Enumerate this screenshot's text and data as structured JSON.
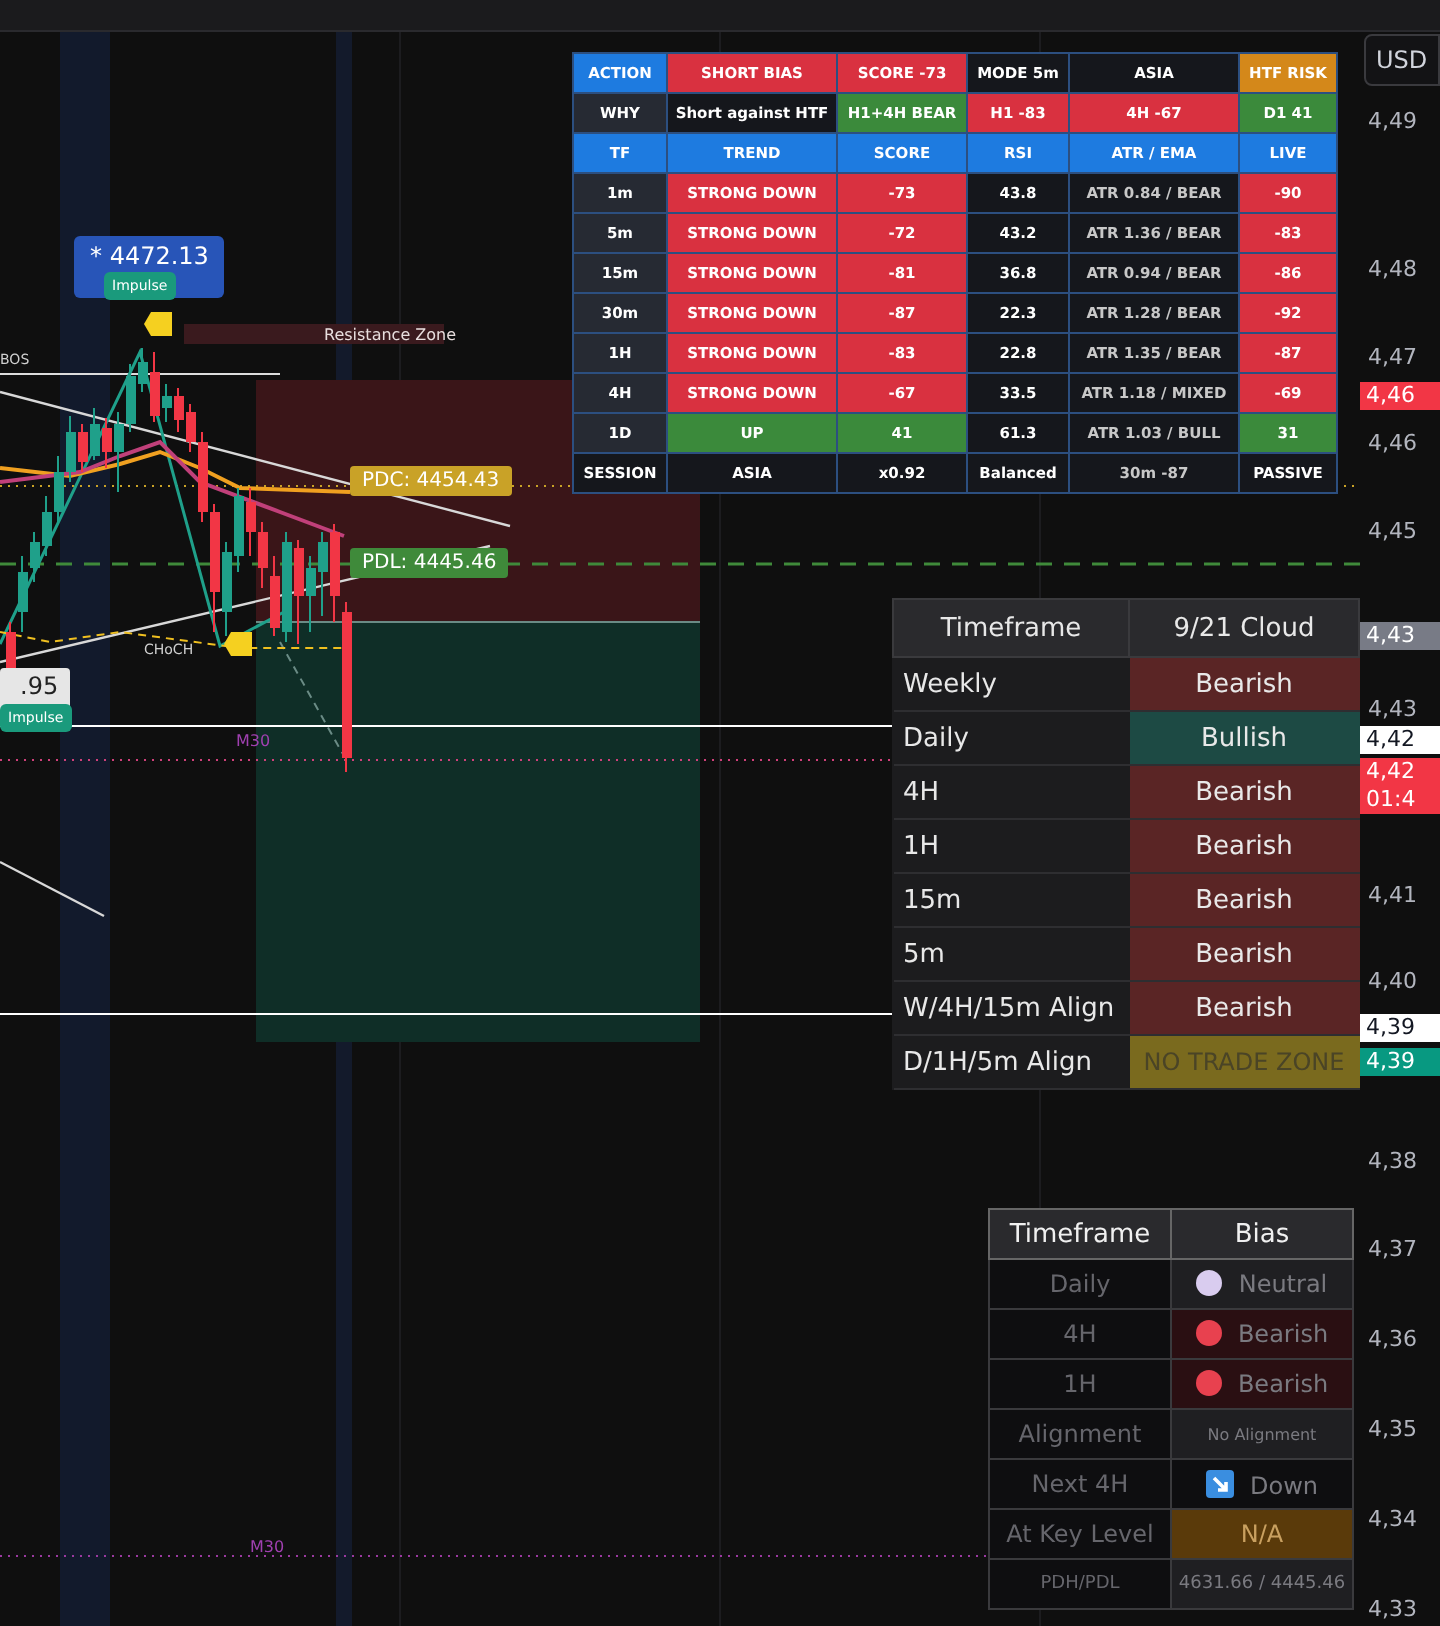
{
  "currency_button": "USD",
  "price_axis": [
    {
      "label": "4,49",
      "kind": "tick"
    },
    {
      "label": "4,48",
      "kind": "tick"
    },
    {
      "label": "4,47",
      "kind": "tick"
    },
    {
      "label": "4,46",
      "kind": "tag",
      "color": "#f23645"
    },
    {
      "label": "4,46",
      "kind": "tick"
    },
    {
      "label": "4,45",
      "kind": "tick"
    },
    {
      "label": "4,43",
      "kind": "tag",
      "color": "#787b86"
    },
    {
      "label": "4,43",
      "kind": "tick"
    },
    {
      "label": "4,42",
      "kind": "tag",
      "color": "#ffffff"
    },
    {
      "label": "4,42\n01:4",
      "kind": "tag",
      "color": "#f23645"
    },
    {
      "label": "4,41",
      "kind": "tick"
    },
    {
      "label": "4,40",
      "kind": "tick"
    },
    {
      "label": "4,39",
      "kind": "tag",
      "color": "#ffffff"
    },
    {
      "label": "4,39",
      "kind": "tag",
      "color": "#089981"
    },
    {
      "label": "4,38",
      "kind": "tick"
    },
    {
      "label": "4,37",
      "kind": "tick"
    },
    {
      "label": "4,36",
      "kind": "tick"
    },
    {
      "label": "4,35",
      "kind": "tick"
    },
    {
      "label": "4,34",
      "kind": "tick"
    },
    {
      "label": "4,33",
      "kind": "tick"
    }
  ],
  "chart_labels": [
    {
      "kind": "price_box",
      "text": "* 4472.13"
    },
    {
      "kind": "impulse",
      "text": "Impulse"
    },
    {
      "kind": "zone",
      "text": "Resistance Zone"
    },
    {
      "kind": "small",
      "text": "BOS"
    },
    {
      "kind": "tag",
      "text": "PDC: 4454.43",
      "color": "#c9a227"
    },
    {
      "kind": "tag",
      "text": "PDL: 4445.46",
      "color": "#3f8a3a"
    },
    {
      "kind": "small",
      "text": "CHoCH"
    },
    {
      "kind": "light_box",
      "text": ".95"
    },
    {
      "kind": "impulse",
      "text": "Impulse"
    },
    {
      "kind": "session",
      "text": "M30"
    },
    {
      "kind": "session",
      "text": "M30"
    }
  ],
  "signal_table": {
    "rows": [
      [
        {
          "text": "ACTION",
          "color": "#1e7be0"
        },
        {
          "text": "SHORT BIAS",
          "color": "#d93140"
        },
        {
          "text": "SCORE -73",
          "color": "#d93140"
        },
        {
          "text": "MODE 5m",
          "color": "#15171c"
        },
        {
          "text": "ASIA",
          "color": "#15171c"
        },
        {
          "text": "HTF RISK",
          "color": "#d4881a"
        }
      ],
      [
        {
          "text": "WHY",
          "color": "#262a33"
        },
        {
          "text": "Short against HTF",
          "color": "#15171c"
        },
        {
          "text": "H1+4H BEAR",
          "color": "#3b8a3b"
        },
        {
          "text": "H1 -83",
          "color": "#d93140"
        },
        {
          "text": "4H -67",
          "color": "#d93140"
        },
        {
          "text": "D1 41",
          "color": "#3b8a3b"
        }
      ],
      [
        {
          "text": "TF",
          "color": "#1e7be0"
        },
        {
          "text": "TREND",
          "color": "#1e7be0"
        },
        {
          "text": "SCORE",
          "color": "#1e7be0"
        },
        {
          "text": "RSI",
          "color": "#1e7be0"
        },
        {
          "text": "ATR / EMA",
          "color": "#1e7be0"
        },
        {
          "text": "LIVE",
          "color": "#1e7be0"
        }
      ],
      [
        {
          "text": "1m",
          "color": "#262a33"
        },
        {
          "text": "STRONG DOWN",
          "color": "#d93140"
        },
        {
          "text": "-73",
          "color": "#d93140"
        },
        {
          "text": "43.8",
          "color": "#15171c"
        },
        {
          "text": "ATR 0.84 / BEAR",
          "color": "#15171c"
        },
        {
          "text": "-90",
          "color": "#d93140"
        }
      ],
      [
        {
          "text": "5m",
          "color": "#262a33"
        },
        {
          "text": "STRONG DOWN",
          "color": "#d93140"
        },
        {
          "text": "-72",
          "color": "#d93140"
        },
        {
          "text": "43.2",
          "color": "#15171c"
        },
        {
          "text": "ATR 1.36 / BEAR",
          "color": "#15171c"
        },
        {
          "text": "-83",
          "color": "#d93140"
        }
      ],
      [
        {
          "text": "15m",
          "color": "#262a33"
        },
        {
          "text": "STRONG DOWN",
          "color": "#d93140"
        },
        {
          "text": "-81",
          "color": "#d93140"
        },
        {
          "text": "36.8",
          "color": "#15171c"
        },
        {
          "text": "ATR 0.94 / BEAR",
          "color": "#15171c"
        },
        {
          "text": "-86",
          "color": "#d93140"
        }
      ],
      [
        {
          "text": "30m",
          "color": "#262a33"
        },
        {
          "text": "STRONG DOWN",
          "color": "#d93140"
        },
        {
          "text": "-87",
          "color": "#d93140"
        },
        {
          "text": "22.3",
          "color": "#15171c"
        },
        {
          "text": "ATR 1.28 / BEAR",
          "color": "#15171c"
        },
        {
          "text": "-92",
          "color": "#d93140"
        }
      ],
      [
        {
          "text": "1H",
          "color": "#262a33"
        },
        {
          "text": "STRONG DOWN",
          "color": "#d93140"
        },
        {
          "text": "-83",
          "color": "#d93140"
        },
        {
          "text": "22.8",
          "color": "#15171c"
        },
        {
          "text": "ATR 1.35 / BEAR",
          "color": "#15171c"
        },
        {
          "text": "-87",
          "color": "#d93140"
        }
      ],
      [
        {
          "text": "4H",
          "color": "#262a33"
        },
        {
          "text": "STRONG DOWN",
          "color": "#d93140"
        },
        {
          "text": "-67",
          "color": "#d93140"
        },
        {
          "text": "33.5",
          "color": "#15171c"
        },
        {
          "text": "ATR 1.18 / MIXED",
          "color": "#15171c"
        },
        {
          "text": "-69",
          "color": "#d93140"
        }
      ],
      [
        {
          "text": "1D",
          "color": "#262a33"
        },
        {
          "text": "UP",
          "color": "#3b8a3b"
        },
        {
          "text": "41",
          "color": "#3b8a3b"
        },
        {
          "text": "61.3",
          "color": "#15171c"
        },
        {
          "text": "ATR 1.03 / BULL",
          "color": "#15171c"
        },
        {
          "text": "31",
          "color": "#3b8a3b"
        }
      ],
      [
        {
          "text": "SESSION",
          "color": "#15171c"
        },
        {
          "text": "ASIA",
          "color": "#15171c"
        },
        {
          "text": "x0.92",
          "color": "#15171c"
        },
        {
          "text": "Balanced",
          "color": "#15171c"
        },
        {
          "text": "30m -87",
          "color": "#15171c"
        },
        {
          "text": "PASSIVE",
          "color": "#15171c"
        }
      ]
    ]
  },
  "cloud_table": {
    "columns": [
      "Timeframe",
      "9/21 Cloud"
    ],
    "rows": [
      {
        "label": "Weekly",
        "value": "Bearish",
        "color": "#5a2525"
      },
      {
        "label": "Daily",
        "value": "Bullish",
        "color": "#1d4a44"
      },
      {
        "label": "4H",
        "value": "Bearish",
        "color": "#5a2525"
      },
      {
        "label": "1H",
        "value": "Bearish",
        "color": "#5a2525"
      },
      {
        "label": "15m",
        "value": "Bearish",
        "color": "#5a2525"
      },
      {
        "label": "5m",
        "value": "Bearish",
        "color": "#5a2525"
      },
      {
        "label": "W/4H/15m Align",
        "value": "Bearish",
        "color": "#5a2525"
      },
      {
        "label": "D/1H/5m Align",
        "value": "NO TRADE ZONE",
        "color": "#7a6a1e"
      }
    ]
  },
  "bias_table": {
    "columns": [
      "Timeframe",
      "Bias"
    ],
    "rows": [
      {
        "label": "Daily",
        "value": "Neutral",
        "kind": "dot",
        "color": "#d9ccef"
      },
      {
        "label": "4H",
        "value": "Bearish",
        "kind": "dot",
        "color": "#e8414f"
      },
      {
        "label": "1H",
        "value": "Bearish",
        "kind": "dot",
        "color": "#e8414f"
      },
      {
        "label": "Alignment",
        "value": "No Alignment",
        "kind": "small"
      },
      {
        "label": "Next 4H",
        "value": "Down",
        "kind": "arrow"
      },
      {
        "label": "At Key Level",
        "value": "N/A",
        "kind": "key"
      },
      {
        "label": "PDH/PDL",
        "value": "4631.66 / 4445.46",
        "kind": "small"
      }
    ]
  }
}
